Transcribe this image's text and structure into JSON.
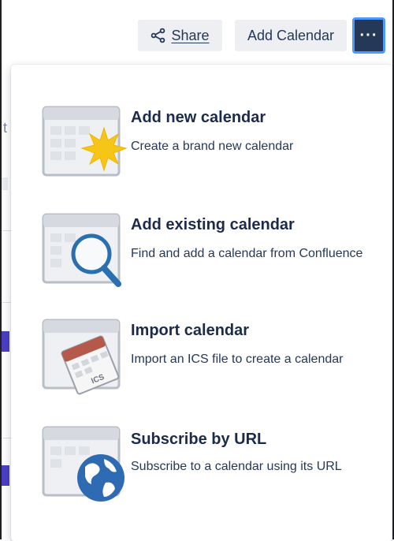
{
  "toolbar": {
    "share_label": "Share",
    "add_calendar_label": "Add Calendar",
    "more_label": "···"
  },
  "background": {
    "glyph": "t"
  },
  "menu": {
    "items": [
      {
        "title": "Add new calendar",
        "description": "Create a brand new calendar",
        "icon": "calendar-sparkle-icon"
      },
      {
        "title": "Add existing calendar",
        "description": "Find and add a calendar from Confluence",
        "icon": "calendar-search-icon"
      },
      {
        "title": "Import calendar",
        "description": "Import an ICS file to create a calendar",
        "icon": "calendar-import-icon",
        "badge": "ICS"
      },
      {
        "title": "Subscribe by URL",
        "description": "Subscribe to a calendar using its URL",
        "icon": "calendar-globe-icon"
      }
    ]
  },
  "colors": {
    "accent": "#253858",
    "focus_ring": "#4c9aff",
    "sparkle": "#f5c518",
    "magnifier": "#2a6fb0",
    "import_sheet": "#b5594a",
    "globe": "#2f6bb3"
  }
}
